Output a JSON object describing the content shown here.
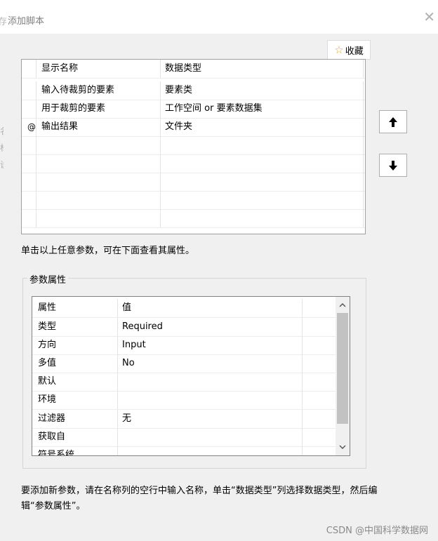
{
  "window": {
    "title_fragment": "存",
    "title": "添加脚本",
    "close_icon": "close-icon"
  },
  "favorite": {
    "label": "收藏",
    "icon": "star-icon",
    "icon_color": "#f5a623"
  },
  "parameters_table": {
    "columns": [
      "显示名称",
      "数据类型"
    ],
    "rows": [
      {
        "marker": "",
        "name": "输入待裁剪的要素",
        "type": "要素类"
      },
      {
        "marker": "",
        "name": "用于裁剪的要素",
        "type": "工作空间 or 要素数据集"
      },
      {
        "marker": "@",
        "name": "输出结果",
        "type": "文件夹"
      }
    ]
  },
  "buttons": {
    "move_up": "arrow-up-icon",
    "move_down": "arrow-down-icon"
  },
  "hint": "单击以上任意参数，可在下面查看其属性。",
  "properties_group": {
    "label": "参数属性",
    "columns": [
      "属性",
      "值"
    ],
    "rows": [
      {
        "name": "类型",
        "value": "Required"
      },
      {
        "name": "方向",
        "value": "Input"
      },
      {
        "name": "多值",
        "value": "No"
      },
      {
        "name": "默认",
        "value": ""
      },
      {
        "name": "环境",
        "value": ""
      },
      {
        "name": "过滤器",
        "value": "无"
      },
      {
        "name": "获取自",
        "value": ""
      },
      {
        "name": "符号系统",
        "value": ""
      }
    ]
  },
  "help_text": "要添加新参数，请在名称列的空行中输入名称，单击“数据类型”列选择数据类型，然后编辑“参数属性”。",
  "watermark": "CSDN @中国科学数据网"
}
